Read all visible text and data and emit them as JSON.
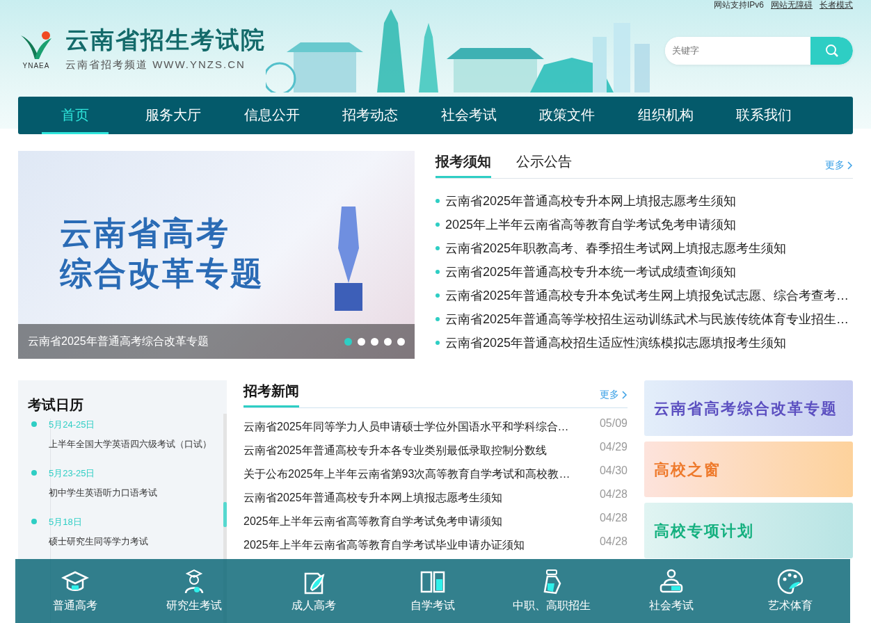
{
  "top_links": [
    "网站支持IPv6",
    "网站无障碍",
    "长者模式"
  ],
  "logo": {
    "mark_text": "YNAEA",
    "title": "云南省招生考试院",
    "subtitle": "云南省招考频道 WWW.YNZS.CN"
  },
  "search": {
    "placeholder": "关键字"
  },
  "nav": [
    {
      "label": "首页",
      "selected": true
    },
    {
      "label": "服务大厅",
      "selected": false
    },
    {
      "label": "信息公开",
      "selected": false
    },
    {
      "label": "招考动态",
      "selected": false
    },
    {
      "label": "社会考试",
      "selected": false
    },
    {
      "label": "政策文件",
      "selected": false
    },
    {
      "label": "组织机构",
      "selected": false
    },
    {
      "label": "联系我们",
      "selected": false
    }
  ],
  "carousel": {
    "headline": [
      "云南省高考",
      "综合改革专题"
    ],
    "caption": "云南省2025年普通高考综合改革专题",
    "dots": [
      {
        "selected": true
      },
      {
        "selected": false
      },
      {
        "selected": false
      },
      {
        "selected": false
      },
      {
        "selected": false
      }
    ]
  },
  "notices": {
    "tabs": [
      {
        "label": "报考须知",
        "selected": true
      },
      {
        "label": "公示公告",
        "selected": false
      }
    ],
    "more": "更多",
    "items": [
      "云南省2025年普通高校专升本网上填报志愿考生须知",
      "2025年上半年云南省高等教育自学考试免考申请须知",
      "云南省2025年职教高考、春季招生考试网上填报志愿考生须知",
      "云南省2025年普通高校专升本统一考试成绩查询须知",
      "云南省2025年普通高校专升本免试考生网上填报免试志愿、综合考查考…",
      "云南省2025年普通高等学校招生运动训练武术与民族传统体育专业招生…",
      "云南省2025年普通高校招生适应性演练模拟志愿填报考生须知"
    ]
  },
  "calendar": {
    "title": "考试日历",
    "items": [
      {
        "date": "5月24-25日",
        "name": "上半年全国大学英语四六级考试（口试）"
      },
      {
        "date": "5月23-25日",
        "name": "初中学生英语听力口语考试"
      },
      {
        "date": "5月18日",
        "name": "硕士研究生同等学力考试"
      }
    ]
  },
  "news": {
    "title": "招考新闻",
    "more": "更多",
    "items": [
      {
        "title": "云南省2025年同等学力人员申请硕士学位外国语水平和学科综合…",
        "date": "05/09"
      },
      {
        "title": "云南省2025年普通高校专升本各专业类别最低录取控制分数线",
        "date": "04/29"
      },
      {
        "title": "关于公布2025年上半年云南省第93次高等教育自学考试和高校教…",
        "date": "04/30"
      },
      {
        "title": "云南省2025年普通高校专升本网上填报志愿考生须知",
        "date": "04/28"
      },
      {
        "title": "2025年上半年云南省高等教育自学考试免考申请须知",
        "date": "04/28"
      },
      {
        "title": "2025年上半年云南省高等教育自学考试毕业申请办证须知",
        "date": "04/28"
      }
    ]
  },
  "banners": [
    {
      "label": "云南省高考综合改革专题",
      "color": "#5b4fc0"
    },
    {
      "label": "高校之窗",
      "color": "#ee7a2c"
    },
    {
      "label": "高校专项计划",
      "color": "#14b07f"
    }
  ],
  "quick_links": [
    {
      "label": "普通高考",
      "kind": "cap"
    },
    {
      "label": "研究生考试",
      "kind": "graduate"
    },
    {
      "label": "成人高考",
      "kind": "pen"
    },
    {
      "label": "自学考试",
      "kind": "book"
    },
    {
      "label": "中职、高职招生",
      "kind": "flask"
    },
    {
      "label": "社会考试",
      "kind": "desk"
    },
    {
      "label": "艺术体育",
      "kind": "palette"
    }
  ]
}
